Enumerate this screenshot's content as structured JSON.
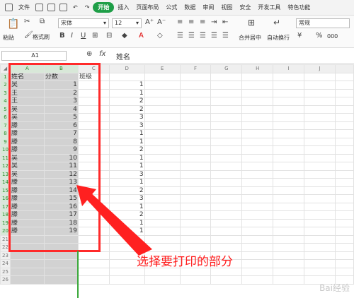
{
  "menubar": {
    "file": "文件",
    "tabs": [
      "开始",
      "插入",
      "页面布局",
      "公式",
      "数据",
      "审阅",
      "视图",
      "安全",
      "开发工具",
      "特色功能"
    ]
  },
  "ribbon": {
    "paste": "粘贴",
    "format_painter": "格式刷",
    "font_name": "宋体",
    "font_size": "12",
    "merge_center": "合并居中",
    "wrap_text": "自动换行",
    "number_format": "常规",
    "percent_symbol": "%",
    "thousands_symbol": "000"
  },
  "formula_bar": {
    "name_box": "A1",
    "fx": "fx",
    "content": "姓名"
  },
  "columns": [
    "A",
    "B",
    "C",
    "D",
    "E",
    "F",
    "G",
    "H",
    "I",
    "J"
  ],
  "rows": [
    [
      "姓名",
      "分数",
      "班级",
      ""
    ],
    [
      "吴",
      "1",
      "",
      "1"
    ],
    [
      "王",
      "2",
      "",
      "1"
    ],
    [
      "王",
      "3",
      "",
      "2"
    ],
    [
      "吴",
      "4",
      "",
      "2"
    ],
    [
      "吴",
      "5",
      "",
      "3"
    ],
    [
      "滕",
      "6",
      "",
      "3"
    ],
    [
      "滕",
      "7",
      "",
      "1"
    ],
    [
      "滕",
      "8",
      "",
      "1"
    ],
    [
      "滕",
      "9",
      "",
      "2"
    ],
    [
      "吴",
      "10",
      "",
      "1"
    ],
    [
      "吴",
      "11",
      "",
      "1"
    ],
    [
      "吴",
      "12",
      "",
      "3"
    ],
    [
      "滕",
      "13",
      "",
      "1"
    ],
    [
      "滕",
      "14",
      "",
      "2"
    ],
    [
      "滕",
      "15",
      "",
      "3"
    ],
    [
      "滕",
      "16",
      "",
      "1"
    ],
    [
      "滕",
      "17",
      "",
      "2"
    ],
    [
      "滕",
      "18",
      "",
      "1"
    ],
    [
      "滕",
      "19",
      "",
      "1"
    ],
    [
      "",
      "",
      "",
      ""
    ],
    [
      "",
      "",
      "",
      ""
    ],
    [
      "",
      "",
      "",
      ""
    ],
    [
      "",
      "",
      "",
      ""
    ],
    [
      "",
      "",
      "",
      ""
    ],
    [
      "",
      "",
      "",
      ""
    ]
  ],
  "annotation": "选择要打印的部分",
  "watermark": "Bai经验"
}
